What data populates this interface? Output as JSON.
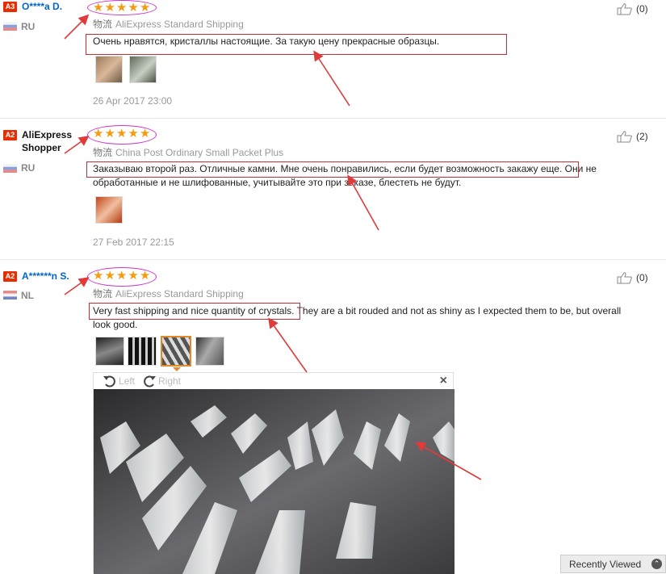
{
  "reviews": [
    {
      "badge": "A3",
      "user": "O****a D.",
      "country": "RU",
      "stars": 5,
      "shipping_label": "物流",
      "shipping": "AliExpress Standard Shipping",
      "text": "Очень нравятся, кристаллы настоящие. За такую цену прекрасные образцы.",
      "photo_count": 2,
      "date": "26 Apr 2017 23:00",
      "likes": "(0)"
    },
    {
      "badge": "A2",
      "user": "AliExpress Shopper",
      "country": "RU",
      "stars": 5,
      "shipping_label": "物流",
      "shipping": "China Post Ordinary Small Packet Plus",
      "text": "Заказываю второй раз. Отличные камни. Мне очень понравились, если будет возможность закажу еще. Они не обработанные и не шлифованные, учитывайте это при заказе, блестеть не будут.",
      "photo_count": 1,
      "date": "27 Feb 2017 22:15",
      "likes": "(2)"
    },
    {
      "badge": "A2",
      "user": "A******n S.",
      "country": "NL",
      "stars": 5,
      "shipping_label": "物流",
      "shipping": "AliExpress Standard Shipping",
      "text": "Very fast shipping and nice quantity of crystals. They are a bit rouded and not as shiny as I expected them to be, but overall look good.",
      "photo_count": 4,
      "likes": "(0)"
    }
  ],
  "viewer": {
    "rotate_left": "Left",
    "rotate_right": "Right",
    "close": "×"
  },
  "recently_viewed": "Recently Viewed",
  "colors": {
    "star": "#f39c12",
    "user_link": "#0066cc",
    "badge": "#e62e04",
    "annotation_red": "#e03b3b",
    "annotation_magenta": "#cc33cc"
  }
}
